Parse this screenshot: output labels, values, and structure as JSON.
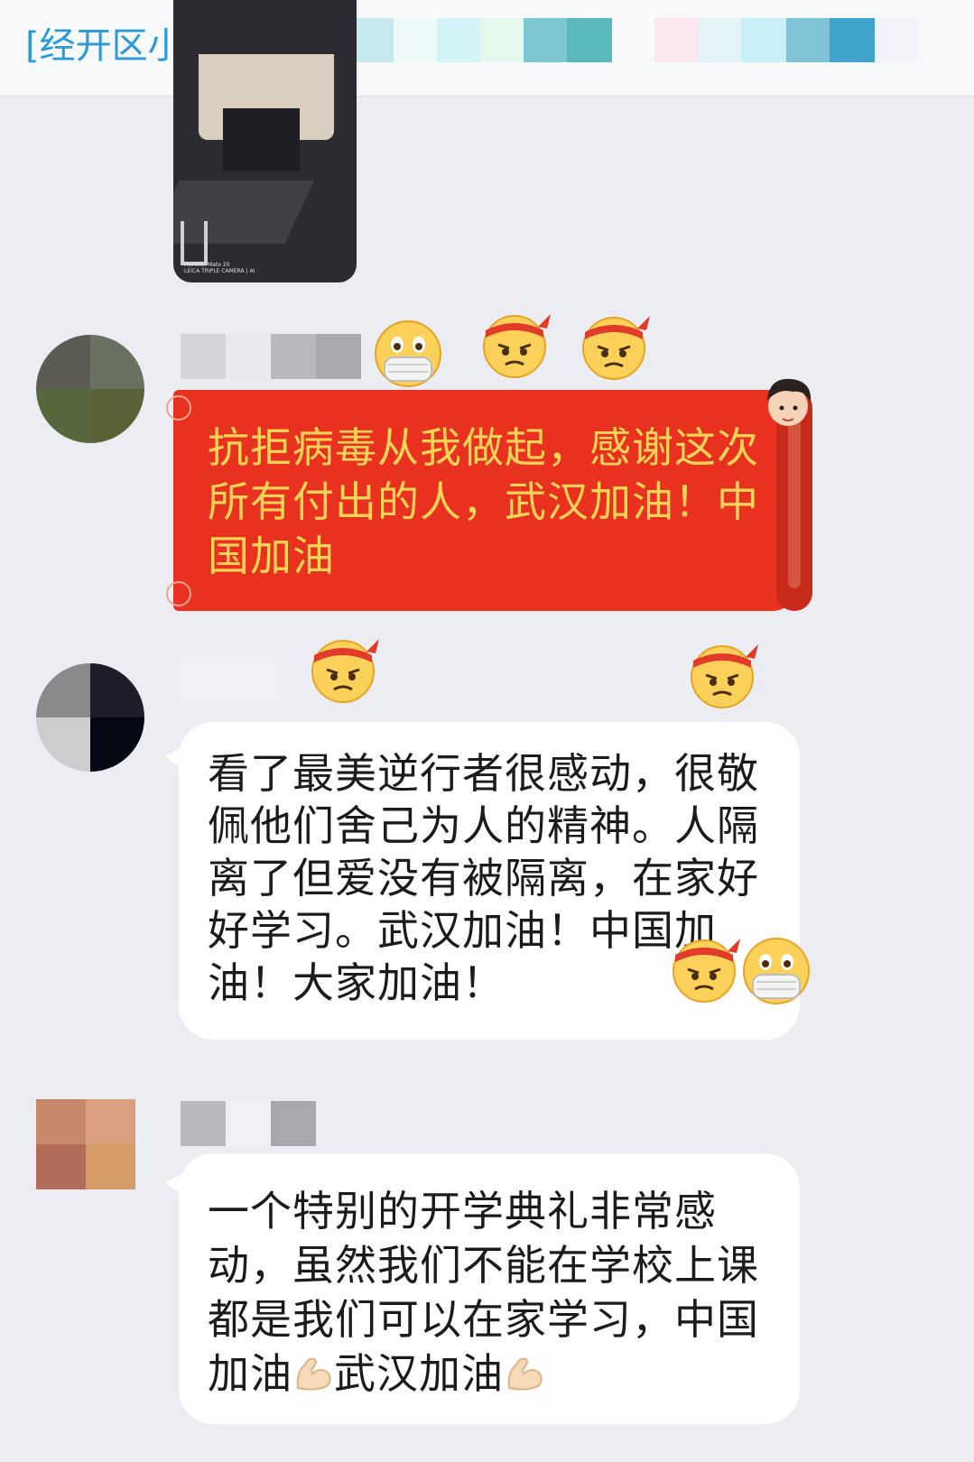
{
  "header": {
    "title": "[经开区小学2"
  },
  "photo": {
    "caption_line1": "HUAWEI Mate 20",
    "caption_line2": "LEICA TRIPLE CAMERA | AI"
  },
  "messages": [
    {
      "type": "sticker_banner",
      "text": "抗拒病毒从我做起，感谢这次所有付出的人，武汉加油！中国加油"
    },
    {
      "type": "text",
      "text": "看了最美逆行者很感动，很敬佩他们舍己为人的精神。人隔离了但爱没有被隔离，在家好好学习。武汉加油！中国加油！大家加油！"
    },
    {
      "type": "text",
      "text_part1": "一个特别的开学典礼非常感动，虽然我们不能在学校上课都是我们可以在家学习，中国加油",
      "text_part2": "武汉加油"
    }
  ],
  "icons": [
    "mask-face-emoji",
    "headband-angry-emoji",
    "flexed-biceps-emoji",
    "cartoon-face-sticker"
  ],
  "colors": {
    "accent": "#2a9ad6",
    "banner_red": "#e8321f",
    "banner_text": "#f6d458",
    "background": "#ebedf3"
  }
}
